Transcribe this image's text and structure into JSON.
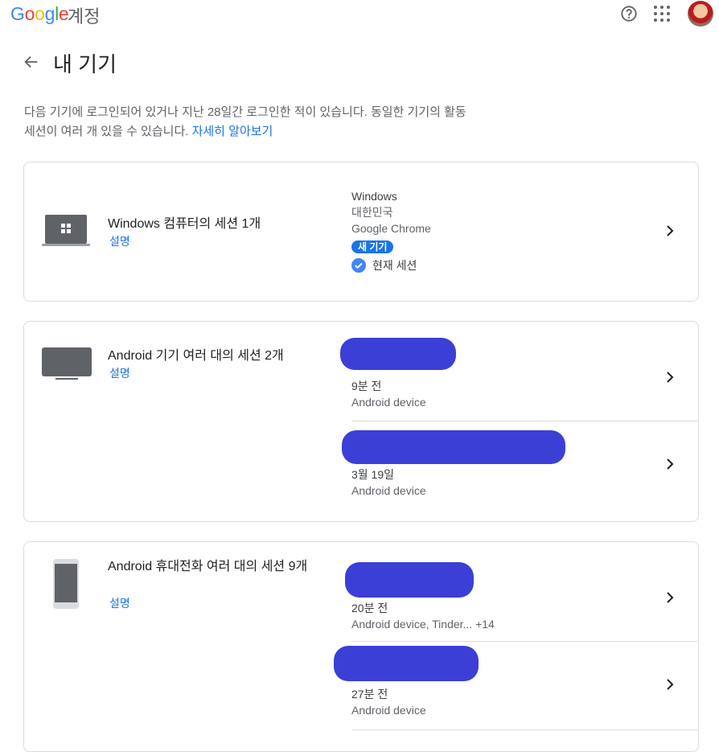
{
  "header": {
    "logo_letters": [
      "G",
      "o",
      "o",
      "g",
      "l",
      "e"
    ],
    "product": "계정",
    "icons": [
      "help-icon",
      "apps-icon",
      "avatar"
    ]
  },
  "page": {
    "back_icon": "arrow-back-icon",
    "title": "내 기기",
    "description": "다음 기기에 로그인되어 있거나 지난 28일간 로그인한 적이 있습니다. 동일한 기기의 활동 세션이 여러 개 있을 수 있습니다.",
    "learn_more": "자세히 알아보기"
  },
  "cards": [
    {
      "title": "Windows 컴퓨터의 세션 1개",
      "link": "설명",
      "icon": "laptop-icon",
      "sessions": [
        {
          "line1": "Windows",
          "line2": "대한민국",
          "line3": "Google Chrome",
          "badge": "새 기기",
          "current": "현재 세션"
        }
      ]
    },
    {
      "title": "Android 기기 여러 대의 세션 2개",
      "link": "설명",
      "icon": "tv-icon",
      "sessions": [
        {
          "time": "9분 전",
          "detail": "Android device"
        },
        {
          "time": "3월 19일",
          "detail": "Android device"
        }
      ]
    },
    {
      "title": "Android 휴대전화 여러 대의 세션 9개",
      "link": "설명",
      "icon": "phone-icon",
      "sessions": [
        {
          "time": "20분 전",
          "detail": "Android device, Tinder... +14"
        },
        {
          "time": "27분 전",
          "detail": "Android device"
        }
      ]
    }
  ]
}
